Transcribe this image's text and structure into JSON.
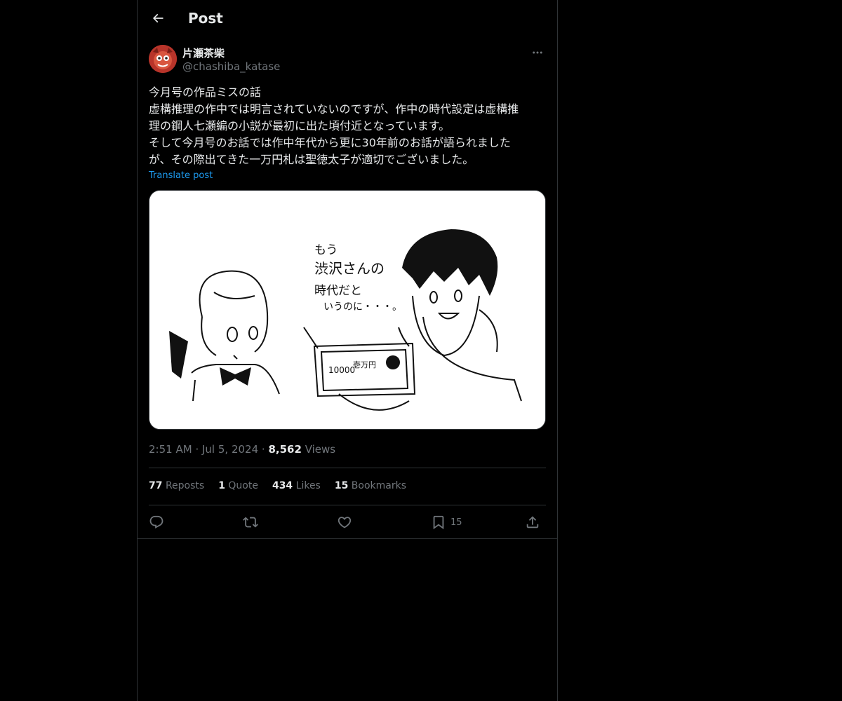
{
  "header": {
    "title": "Post",
    "back_icon": "arrow-left-icon"
  },
  "author": {
    "name": "片瀬茶柴",
    "handle": "@chashiba_katase",
    "avatar_icon": "avatar-illustration"
  },
  "post": {
    "lines": [
      "今月号の作品ミスの話",
      "虚構推理の作中では明言されていないのですが、作中の時代設定は虚構推",
      "理の鋼人七瀬編の小説が最初に出た頃付近となっています。",
      "そして今月号のお話では作中年代から更に30年前のお話が語られました",
      "が、その際出てきた一万円札は聖徳太子が適切でございました。"
    ],
    "translate_label": "Translate post",
    "image": {
      "speech_lines": [
        "もう",
        "渋沢さんの",
        "時代だと",
        "いうのに・・・。"
      ],
      "banknote_text": [
        "10000",
        "壱万円"
      ]
    }
  },
  "meta": {
    "time": "2:51 AM",
    "date": "Jul 5, 2024",
    "views_count": "8,562",
    "views_label": "Views",
    "separator": "·"
  },
  "stats": {
    "reposts": {
      "count": "77",
      "label": "Reposts"
    },
    "quotes": {
      "count": "1",
      "label": "Quote"
    },
    "likes": {
      "count": "434",
      "label": "Likes"
    },
    "bookmarks": {
      "count": "15",
      "label": "Bookmarks"
    }
  },
  "actions": {
    "reply_icon": "reply-icon",
    "repost_icon": "repost-icon",
    "like_icon": "like-icon",
    "bookmark_icon": "bookmark-icon",
    "bookmark_count": "15",
    "share_icon": "share-icon"
  },
  "colors": {
    "background": "#000000",
    "text": "#e7e9ea",
    "muted": "#71767b",
    "link": "#1d9bf0",
    "border": "#2f3336"
  }
}
